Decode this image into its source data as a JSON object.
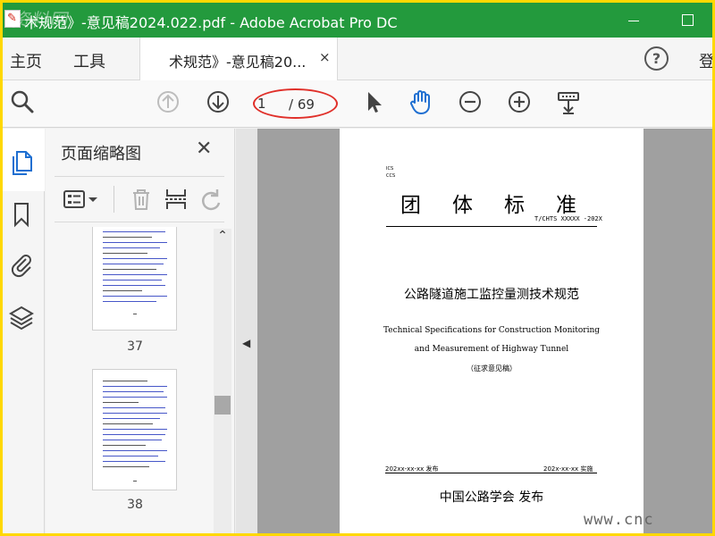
{
  "window": {
    "title": "术规范》-意见稿2024.022.pdf - Adobe Acrobat Pro DC",
    "watermark": "资料网"
  },
  "menu": {
    "home": "主页",
    "tools": "工具",
    "doc_tab": "术规范》-意见稿20...",
    "doc_tab_close": "×",
    "help": "?",
    "signin": "登"
  },
  "toolbar": {
    "current_page": "1",
    "total_pages": "/ 69"
  },
  "panel": {
    "title": "页面缩略图",
    "close": "✕",
    "thumbnails": [
      {
        "label": "37"
      },
      {
        "label": "38"
      }
    ]
  },
  "document": {
    "ics": "ICS",
    "ccs": "CCS",
    "standard_title": "团体标准",
    "standard_code": "T/CHTS XXXXX -202X",
    "cn_title": "公路隧道施工监控量测技术规范",
    "en_title_line1": "Technical Specifications for Construction Monitoring",
    "en_title_line2": "and Measurement of Highway Tunnel",
    "draft_note": "（征求意见稿）",
    "issue_date": "202xx-xx-xx 发布",
    "impl_date": "202x-xx-xx 实施",
    "publisher": "中国公路学会  发布"
  },
  "overlay": {
    "watermark_text": "www.cnc"
  },
  "colors": {
    "titlebar": "#239a3d",
    "highlight": "#e0302a",
    "hand_tool": "#1f6fd1",
    "frame": "#ffd800"
  }
}
